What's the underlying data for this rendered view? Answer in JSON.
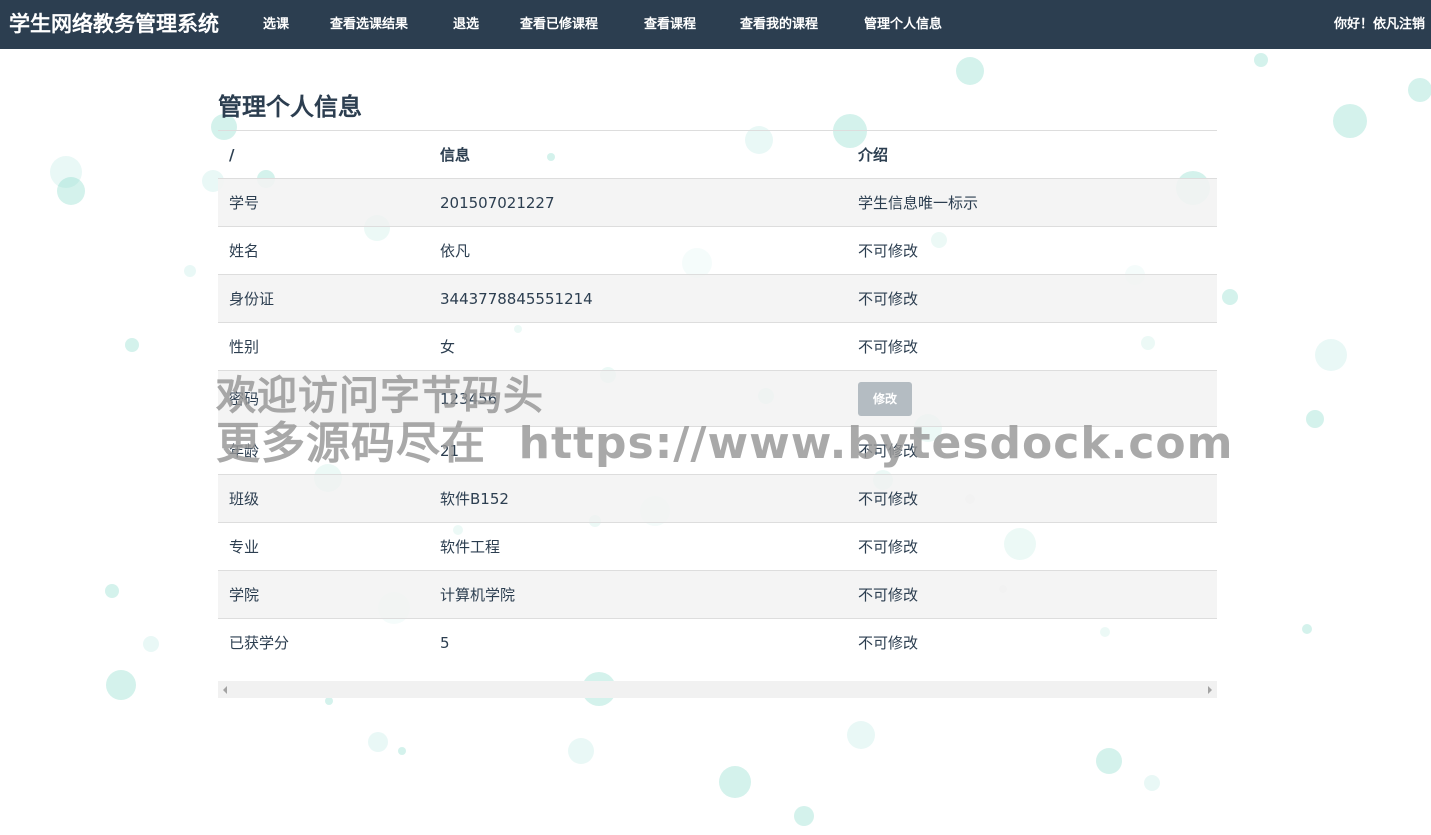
{
  "app": {
    "brand": "学生网络教务管理系统"
  },
  "nav": {
    "items": [
      "选课",
      "查看选课结果",
      "退选",
      "查看已修课程",
      "查看课程",
      "查看我的课程",
      "管理个人信息"
    ],
    "greeting": "你好！依凡",
    "logout": "注销"
  },
  "page": {
    "title": "管理个人信息"
  },
  "table": {
    "headers": [
      "/",
      "信息",
      "介绍"
    ],
    "rows": [
      {
        "field": "学号",
        "value": "201507021227",
        "note": "学生信息唯一标示"
      },
      {
        "field": "姓名",
        "value": "依凡",
        "note": "不可修改"
      },
      {
        "field": "身份证",
        "value": "3443778845551214",
        "note": "不可修改"
      },
      {
        "field": "性别",
        "value": "女",
        "note": "不可修改"
      },
      {
        "field": "密码",
        "value": "123456",
        "note": "",
        "action_label": "修改"
      },
      {
        "field": "年龄",
        "value": "21",
        "note": "不可修改"
      },
      {
        "field": "班级",
        "value": "软件B152",
        "note": "不可修改"
      },
      {
        "field": "专业",
        "value": "软件工程",
        "note": "不可修改"
      },
      {
        "field": "学院",
        "value": "计算机学院",
        "note": "不可修改"
      },
      {
        "field": "已获学分",
        "value": "5",
        "note": "不可修改"
      }
    ]
  },
  "watermark": {
    "line1": "欢迎访问字节码头",
    "line2": "更多源码尽在  https://www.bytesdock.com"
  },
  "colors": {
    "navbar": "#2c3e50",
    "text": "#2c3e50",
    "stripe": "#f2f2f2",
    "button": "#b4bcc2",
    "bubble": "#78d6c4"
  }
}
